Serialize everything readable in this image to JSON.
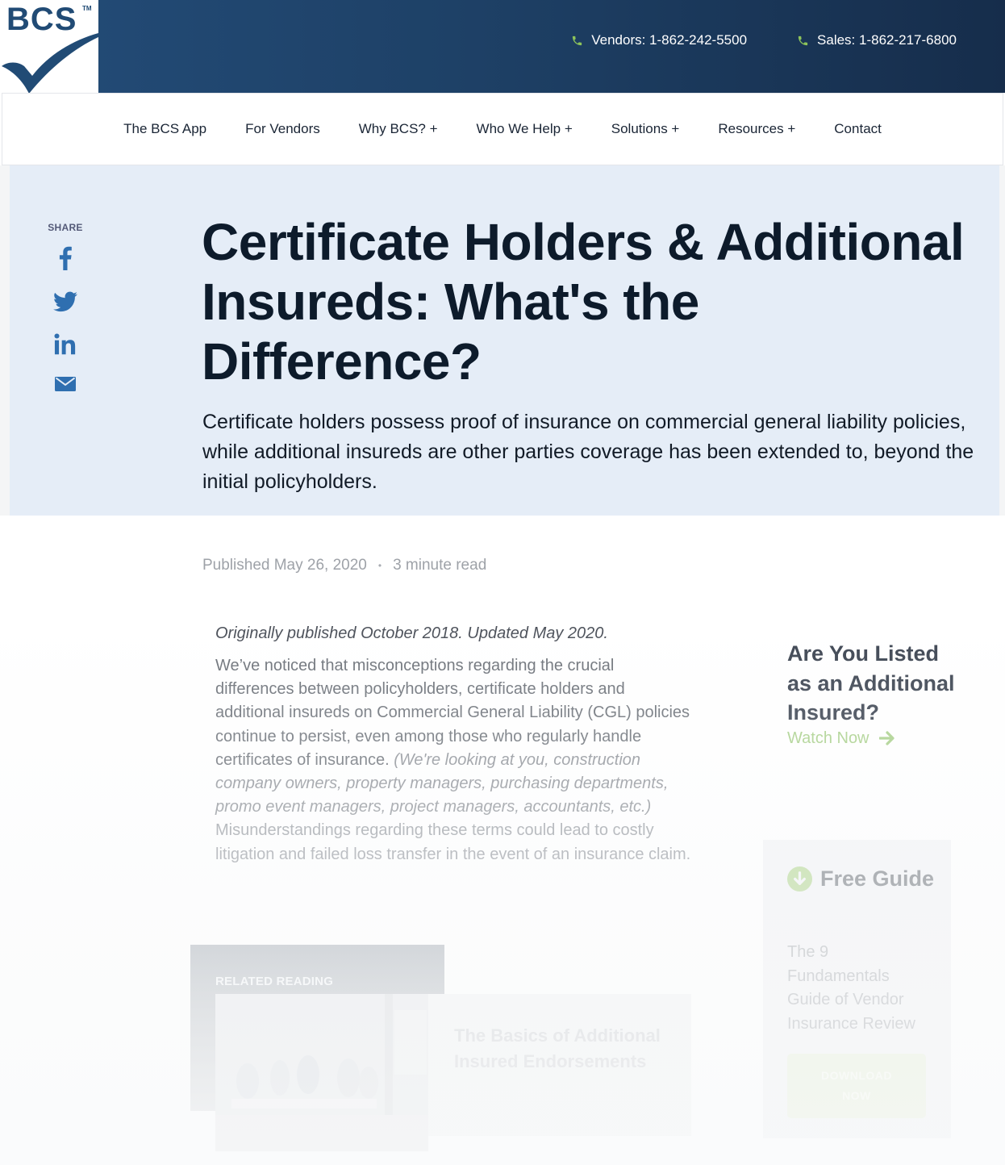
{
  "brand": {
    "logo_text": "BCS",
    "logo_tm": "TM",
    "colors": {
      "primary": "#214b75",
      "accent_green": "#8dc35a",
      "hero_bg": "#e5edf7",
      "title": "#0d1b2b"
    }
  },
  "header": {
    "phones": [
      {
        "icon": "phone-icon",
        "label": "Vendors: 1-862-242-5500"
      },
      {
        "icon": "phone-icon",
        "label": "Sales: 1-862-217-6800"
      }
    ]
  },
  "nav": {
    "items": [
      {
        "label": "The BCS App"
      },
      {
        "label": "For Vendors"
      },
      {
        "label": "Why BCS? +"
      },
      {
        "label": "Who We Help +"
      },
      {
        "label": "Solutions +"
      },
      {
        "label": "Resources +"
      },
      {
        "label": "Contact"
      }
    ]
  },
  "share": {
    "label": "SHARE",
    "icons": [
      "facebook-icon",
      "twitter-icon",
      "linkedin-icon",
      "email-icon"
    ]
  },
  "hero": {
    "title": "Certificate Holders & Additional Insureds: What's the Difference?",
    "description": "Certificate holders possess proof of insurance on commercial general liability policies, while additional insureds are other parties coverage has been extended to, beyond the initial policyholders."
  },
  "meta": {
    "published": "Published May 26, 2020",
    "separator": "•",
    "read_time": "3 minute read"
  },
  "article": {
    "original_note": "Originally published October 2018. Updated May 2020.",
    "para_part1": "We’ve noticed that misconceptions regarding the crucial differences between policyholders, certificate holders and additional insureds on Commercial General Liability (CGL) policies continue to persist, even among those who regularly handle certificates of insurance. ",
    "para_italic": "(We're looking at you, construction company owners, property managers, purchasing departments, promo event managers, project managers, accountants, etc.)",
    "para_part2": " Misunderstandings regarding these terms could lead to costly litigation and failed loss transfer in the event of an insurance claim."
  },
  "cta": {
    "title": "Are You Listed as an Additional Insured?",
    "link_label": "Watch Now"
  },
  "guide": {
    "heading": "Free Guide",
    "description": "The 9 Fundamentals Guide of Vendor Insurance Review",
    "button_label": "DOWNLOAD NOW"
  },
  "related": {
    "label": "RELATED READING",
    "title": "The Basics of Additional Insured Endorsements"
  }
}
